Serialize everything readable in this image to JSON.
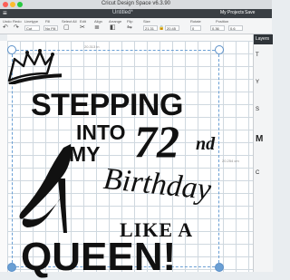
{
  "window": {
    "title": "Cricut Design Space v6.3.90"
  },
  "header": {
    "menu_icon": "hamburger-icon",
    "doc_title": "Untitled*",
    "my_projects": "My Projects",
    "save": "Save"
  },
  "toolbar": {
    "labels": [
      "Undo",
      "Redo",
      "Linetype",
      "Fill",
      "Select All",
      "Edit",
      "Align",
      "Arrange",
      "Flip",
      "Size",
      "Rotate",
      "Position"
    ],
    "linetype_value": "Cut",
    "fill_value": "No Fill",
    "size_w": "21.31",
    "size_h": "20.45",
    "rotate": "0",
    "pos_x": "0.36",
    "pos_y": "0.6"
  },
  "canvas": {
    "width_readout": "20.313 in",
    "height_readout": "20.254 cm",
    "artwork": {
      "line1": "STEPPING",
      "line2": "INTO",
      "line3": "MY",
      "number": "72",
      "suffix": "nd",
      "script": "Birthday",
      "line4": "LIKE A",
      "line5": "QUEEN!"
    }
  },
  "right_panel": {
    "tab": "Layers",
    "items": [
      "T",
      "Y",
      "S",
      "M",
      "C"
    ]
  },
  "colors": {
    "header_bg": "#3a3f44",
    "selection": "#6a9fd4",
    "grid": "#cfd8df"
  }
}
